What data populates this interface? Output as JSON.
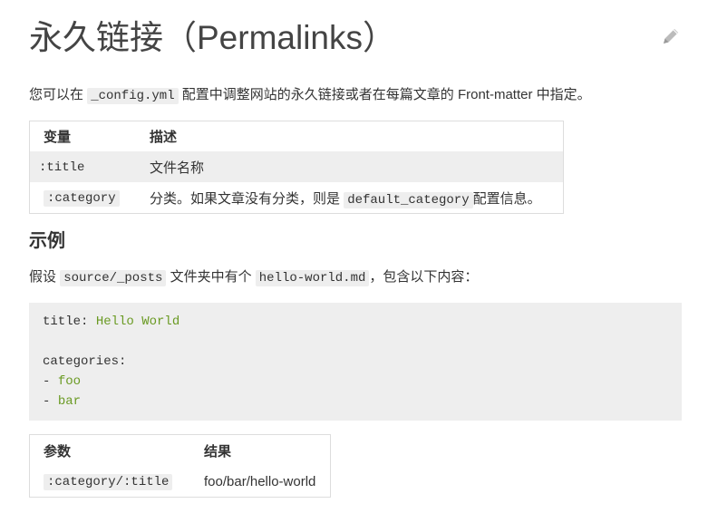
{
  "header": {
    "title": "永久链接（Permalinks）",
    "edit_icon": "pencil-icon"
  },
  "intro": {
    "before": "您可以在",
    "code": "_config.yml",
    "after": "配置中调整网站的永久链接或者在每篇文章的 Front-matter 中指定。"
  },
  "vars_table": {
    "headers": [
      "变量",
      "描述"
    ],
    "rows": [
      {
        "var": ":title",
        "desc": "文件名称"
      },
      {
        "var": ":category",
        "desc_before": "分类。如果文章没有分类，则是",
        "desc_code": "default_category",
        "desc_after": "配置信息。"
      }
    ]
  },
  "example": {
    "heading": "示例",
    "intro_before": "假设",
    "intro_code1": "source/_posts",
    "intro_mid": "文件夹中有个",
    "intro_code2": "hello-world.md",
    "intro_after": "，包含以下内容：",
    "code_lines": {
      "title_key": "title: ",
      "title_val": "Hello World",
      "categories_key": "categories:",
      "dash": "- ",
      "cat1": "foo",
      "cat2": "bar"
    }
  },
  "result_table": {
    "headers": [
      "参数",
      "结果"
    ],
    "rows": [
      {
        "param": ":category/:title",
        "result": "foo/bar/hello-world"
      }
    ]
  }
}
